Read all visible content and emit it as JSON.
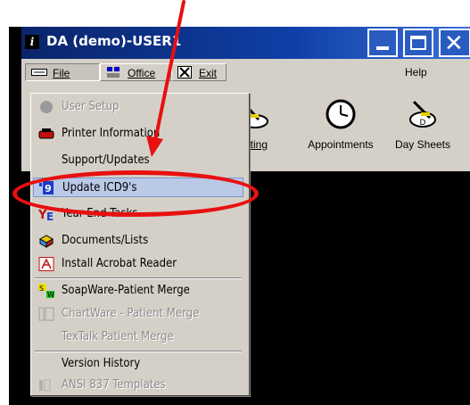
{
  "window": {
    "title": "DA (demo)-USER1",
    "title_icon": "i"
  },
  "menubar": {
    "file": "File",
    "office": "Office",
    "exit": "Exit",
    "help": "Help"
  },
  "toolbar": {
    "posting": "osting",
    "appointments": "Appointments",
    "day_sheets": "Day Sheets"
  },
  "file_menu": {
    "items": [
      {
        "label": "User Setup",
        "enabled": false,
        "icon": "gray-circle-icon"
      },
      {
        "label": "Printer Information",
        "enabled": true,
        "icon": "printer-icon"
      },
      {
        "label": "Support/Updates",
        "enabled": true,
        "icon": "none"
      },
      {
        "label": "Update ICD9's",
        "enabled": true,
        "selected": true,
        "icon": "icd9-update-icon"
      },
      {
        "label": "Year End Tasks",
        "enabled": true,
        "icon": "year-end-icon"
      },
      {
        "label": "Documents/Lists",
        "enabled": true,
        "icon": "documents-icon"
      },
      {
        "label": "Install Acrobat Reader",
        "enabled": true,
        "icon": "acrobat-icon"
      },
      {
        "label": "SoapWare-Patient Merge",
        "enabled": true,
        "icon": "soapware-icon"
      },
      {
        "label": "ChartWare - Patient Merge",
        "enabled": false,
        "icon": "chartware-icon"
      },
      {
        "label": "TexTalk Patient Merge",
        "enabled": false,
        "icon": "none"
      },
      {
        "label": "Version History",
        "enabled": true,
        "icon": "none"
      },
      {
        "label": "ANSI 837 Templates",
        "enabled": false,
        "icon": "ansi-template-icon"
      }
    ]
  },
  "annotation_color": "#e81010",
  "title_bar_color": "#0a246a"
}
